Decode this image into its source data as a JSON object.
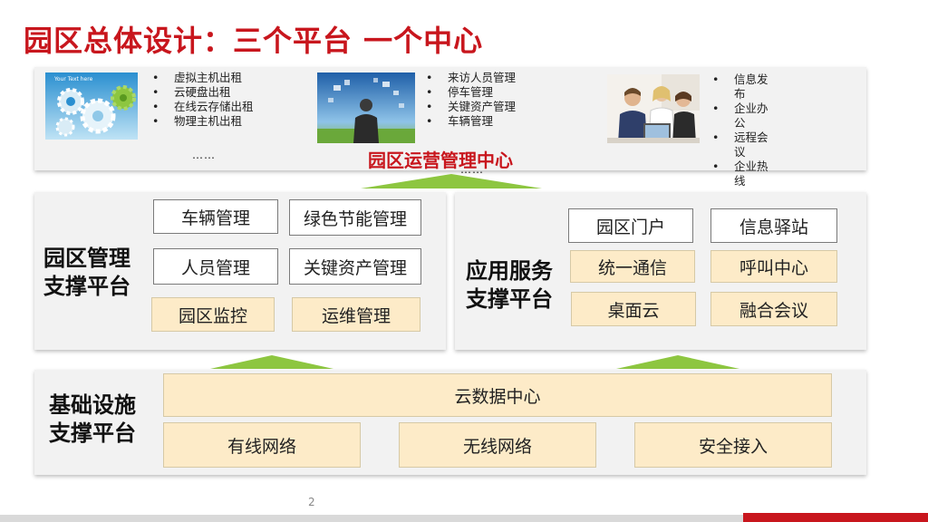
{
  "title": "园区总体设计：三个平台 一个中心",
  "top_panel": {
    "center_label": "园区运营管理中心",
    "photo1_caption": "Your Text here",
    "list1": [
      "虚拟主机出租",
      "云硬盘出租",
      "在线云存储出租",
      "物理主机出租"
    ],
    "list1_more": "……",
    "list2": [
      "来访人员管理",
      "停车管理",
      "关键资产管理",
      "车辆管理"
    ],
    "list2_more": "……",
    "list3": [
      "信息发布",
      "企业办公",
      "远程会议",
      "企业热线"
    ],
    "list3_more": "……"
  },
  "mgmt_platform": {
    "title_line1": "园区管理",
    "title_line2": "支撑平台",
    "items": [
      "车辆管理",
      "绿色节能管理",
      "人员管理",
      "关键资产管理",
      "园区监控",
      "运维管理"
    ]
  },
  "app_platform": {
    "title_line1": "应用服务",
    "title_line2": "支撑平台",
    "items": [
      "园区门户",
      "信息驿站",
      "统一通信",
      "呼叫中心",
      "桌面云",
      "融合会议"
    ]
  },
  "infra_platform": {
    "title_line1": "基础设施",
    "title_line2": "支撑平台",
    "data_center": "云数据中心",
    "items": [
      "有线网络",
      "无线网络",
      "安全接入"
    ]
  },
  "page_number": "2",
  "colors": {
    "title_red": "#c8161d",
    "arrow_green": "#8dc640",
    "tan_box": "#fdebc8",
    "panel_bg": "#f2f2f2"
  }
}
